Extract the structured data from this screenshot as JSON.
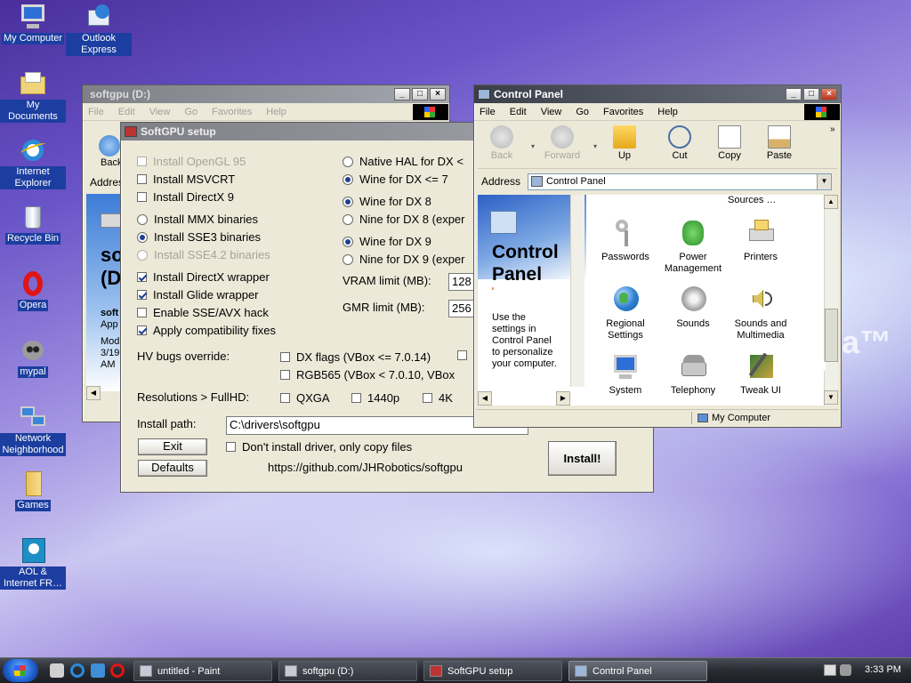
{
  "desktop": {
    "watermark": "a™",
    "icons": [
      {
        "label": "My Computer",
        "icon": "my-computer-icon"
      },
      {
        "label": "Outlook Express",
        "icon": "outlook-express-icon"
      },
      {
        "label": "My Documents",
        "icon": "my-documents-icon"
      },
      {
        "label": "Internet Explorer",
        "icon": "internet-explorer-icon"
      },
      {
        "label": "Recycle Bin",
        "icon": "recycle-bin-icon"
      },
      {
        "label": "Opera",
        "icon": "opera-icon"
      },
      {
        "label": "mypal",
        "icon": "mypal-icon"
      },
      {
        "label": "Network Neighborhood",
        "icon": "network-neighborhood-icon"
      },
      {
        "label": "Games",
        "icon": "games-folder-icon"
      },
      {
        "label": "AOL & Internet FR…",
        "icon": "aol-icon"
      }
    ]
  },
  "softgpu_window": {
    "title": "softgpu (D:)",
    "menu": [
      "File",
      "Edit",
      "View",
      "Go",
      "Favorites",
      "Help"
    ],
    "back_label": "Back",
    "address_label": "Addres",
    "folder_title_lines": [
      "so",
      "(D"
    ],
    "detail_lines": [
      "soft",
      "App",
      "Mod",
      "3/19",
      "AM"
    ]
  },
  "setup": {
    "title": "SoftGPU setup",
    "left_options": [
      {
        "label": "Install OpenGL 95",
        "kind": "checkbox",
        "checked": false,
        "disabled": true
      },
      {
        "label": "Install MSVCRT",
        "kind": "checkbox",
        "checked": false,
        "disabled": false
      },
      {
        "label": "Install DirectX 9",
        "kind": "checkbox",
        "checked": false,
        "disabled": false
      },
      {
        "label": "Install MMX binaries",
        "kind": "radio",
        "checked": false,
        "disabled": false
      },
      {
        "label": "Install SSE3 binaries",
        "kind": "radio",
        "checked": true,
        "disabled": false
      },
      {
        "label": "Install SSE4.2 binaries",
        "kind": "radio",
        "checked": true,
        "disabled": true
      },
      {
        "label": "Install DirectX wrapper",
        "kind": "checkbox",
        "checked": true,
        "disabled": false
      },
      {
        "label": "Install Glide wrapper",
        "kind": "checkbox",
        "checked": true,
        "disabled": false
      },
      {
        "label": "Enable SSE/AVX hack",
        "kind": "checkbox",
        "checked": false,
        "disabled": false
      },
      {
        "label": "Apply compatibility fixes",
        "kind": "checkbox",
        "checked": true,
        "disabled": false
      }
    ],
    "right_options": [
      {
        "label": "Native HAL for DX <",
        "checked": false
      },
      {
        "label": "Wine for DX <= 7",
        "checked": true
      },
      {
        "label": "Wine for DX 8",
        "checked": true
      },
      {
        "label": "Nine for DX 8 (exper",
        "checked": false
      },
      {
        "label": "Wine for DX 9",
        "checked": true
      },
      {
        "label": "Nine for DX 9 (exper",
        "checked": false
      }
    ],
    "vram_label": "VRAM limit (MB):",
    "vram_value": "128",
    "gmr_label": "GMR limit (MB):",
    "gmr_value": "256",
    "hv_label": "HV bugs override:",
    "hv_options": [
      "DX flags (VBox <= 7.0.14)",
      "RGB565 (VBox < 7.0.10, VBox"
    ],
    "res_label": "Resolutions > FullHD:",
    "res_options": [
      "QXGA",
      "1440p",
      "4K"
    ],
    "install_path_label": "Install path:",
    "install_path_value": "C:\\drivers\\softgpu",
    "exit_label": "Exit",
    "defaults_label": "Defaults",
    "copy_only_label": "Don't install driver, only copy files",
    "url": "https://github.com/JHRobotics/softgpu",
    "install_label": "Install!"
  },
  "control_panel": {
    "title": "Control Panel",
    "menu": [
      "File",
      "Edit",
      "View",
      "Go",
      "Favorites",
      "Help"
    ],
    "toolbar": [
      {
        "label": "Back",
        "icon": "back-arrow-icon",
        "enabled": false
      },
      {
        "label": "Forward",
        "icon": "forward-arrow-icon",
        "enabled": false
      },
      {
        "label": "Up",
        "icon": "up-folder-icon",
        "enabled": true
      },
      {
        "label": "Cut",
        "icon": "scissors-icon",
        "enabled": true
      },
      {
        "label": "Copy",
        "icon": "copy-icon",
        "enabled": true
      },
      {
        "label": "Paste",
        "icon": "paste-icon",
        "enabled": true
      }
    ],
    "address_label": "Address",
    "address_value": "Control Panel",
    "left_title_lines": [
      "Control",
      "Panel"
    ],
    "left_desc": "Use the settings in Control Panel to personalize your computer.",
    "partial_item": "Sources …",
    "items": [
      {
        "label": "Passwords",
        "icon": "passwords-key-icon"
      },
      {
        "label": "Power Management",
        "icon": "power-management-icon"
      },
      {
        "label": "Printers",
        "icon": "printers-icon"
      },
      {
        "label": "Regional Settings",
        "icon": "regional-settings-globe-icon"
      },
      {
        "label": "Sounds",
        "icon": "sounds-icon"
      },
      {
        "label": "Sounds and Multimedia",
        "icon": "sounds-multimedia-icon"
      },
      {
        "label": "System",
        "icon": "system-icon"
      },
      {
        "label": "Telephony",
        "icon": "telephony-icon"
      },
      {
        "label": "Tweak UI",
        "icon": "tweak-ui-icon"
      }
    ],
    "status_text": "My Computer"
  },
  "taskbar": {
    "tasks": [
      "untitled - Paint",
      "softgpu (D:)",
      "SoftGPU setup",
      "Control Panel"
    ],
    "clock": "3:33 PM"
  }
}
